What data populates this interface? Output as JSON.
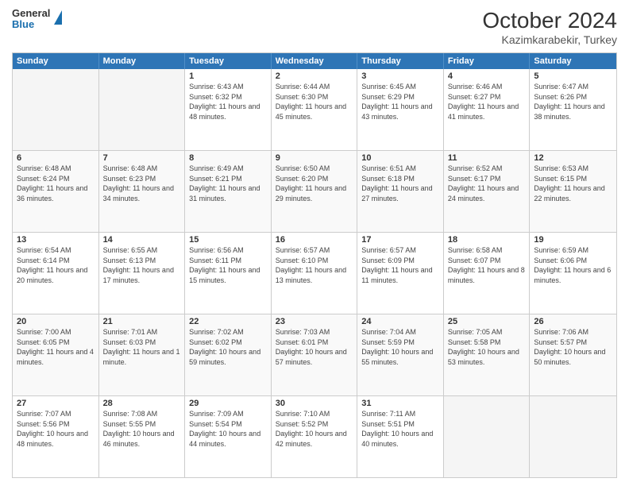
{
  "header": {
    "logo_line1": "General",
    "logo_line2": "Blue",
    "title": "October 2024",
    "subtitle": "Kazimkarabekir, Turkey"
  },
  "days_of_week": [
    "Sunday",
    "Monday",
    "Tuesday",
    "Wednesday",
    "Thursday",
    "Friday",
    "Saturday"
  ],
  "weeks": [
    [
      {
        "day": "",
        "info": "",
        "empty": true
      },
      {
        "day": "",
        "info": "",
        "empty": true
      },
      {
        "day": "1",
        "info": "Sunrise: 6:43 AM\nSunset: 6:32 PM\nDaylight: 11 hours and 48 minutes."
      },
      {
        "day": "2",
        "info": "Sunrise: 6:44 AM\nSunset: 6:30 PM\nDaylight: 11 hours and 45 minutes."
      },
      {
        "day": "3",
        "info": "Sunrise: 6:45 AM\nSunset: 6:29 PM\nDaylight: 11 hours and 43 minutes."
      },
      {
        "day": "4",
        "info": "Sunrise: 6:46 AM\nSunset: 6:27 PM\nDaylight: 11 hours and 41 minutes."
      },
      {
        "day": "5",
        "info": "Sunrise: 6:47 AM\nSunset: 6:26 PM\nDaylight: 11 hours and 38 minutes."
      }
    ],
    [
      {
        "day": "6",
        "info": "Sunrise: 6:48 AM\nSunset: 6:24 PM\nDaylight: 11 hours and 36 minutes."
      },
      {
        "day": "7",
        "info": "Sunrise: 6:48 AM\nSunset: 6:23 PM\nDaylight: 11 hours and 34 minutes."
      },
      {
        "day": "8",
        "info": "Sunrise: 6:49 AM\nSunset: 6:21 PM\nDaylight: 11 hours and 31 minutes."
      },
      {
        "day": "9",
        "info": "Sunrise: 6:50 AM\nSunset: 6:20 PM\nDaylight: 11 hours and 29 minutes."
      },
      {
        "day": "10",
        "info": "Sunrise: 6:51 AM\nSunset: 6:18 PM\nDaylight: 11 hours and 27 minutes."
      },
      {
        "day": "11",
        "info": "Sunrise: 6:52 AM\nSunset: 6:17 PM\nDaylight: 11 hours and 24 minutes."
      },
      {
        "day": "12",
        "info": "Sunrise: 6:53 AM\nSunset: 6:15 PM\nDaylight: 11 hours and 22 minutes."
      }
    ],
    [
      {
        "day": "13",
        "info": "Sunrise: 6:54 AM\nSunset: 6:14 PM\nDaylight: 11 hours and 20 minutes."
      },
      {
        "day": "14",
        "info": "Sunrise: 6:55 AM\nSunset: 6:13 PM\nDaylight: 11 hours and 17 minutes."
      },
      {
        "day": "15",
        "info": "Sunrise: 6:56 AM\nSunset: 6:11 PM\nDaylight: 11 hours and 15 minutes."
      },
      {
        "day": "16",
        "info": "Sunrise: 6:57 AM\nSunset: 6:10 PM\nDaylight: 11 hours and 13 minutes."
      },
      {
        "day": "17",
        "info": "Sunrise: 6:57 AM\nSunset: 6:09 PM\nDaylight: 11 hours and 11 minutes."
      },
      {
        "day": "18",
        "info": "Sunrise: 6:58 AM\nSunset: 6:07 PM\nDaylight: 11 hours and 8 minutes."
      },
      {
        "day": "19",
        "info": "Sunrise: 6:59 AM\nSunset: 6:06 PM\nDaylight: 11 hours and 6 minutes."
      }
    ],
    [
      {
        "day": "20",
        "info": "Sunrise: 7:00 AM\nSunset: 6:05 PM\nDaylight: 11 hours and 4 minutes."
      },
      {
        "day": "21",
        "info": "Sunrise: 7:01 AM\nSunset: 6:03 PM\nDaylight: 11 hours and 1 minute."
      },
      {
        "day": "22",
        "info": "Sunrise: 7:02 AM\nSunset: 6:02 PM\nDaylight: 10 hours and 59 minutes."
      },
      {
        "day": "23",
        "info": "Sunrise: 7:03 AM\nSunset: 6:01 PM\nDaylight: 10 hours and 57 minutes."
      },
      {
        "day": "24",
        "info": "Sunrise: 7:04 AM\nSunset: 5:59 PM\nDaylight: 10 hours and 55 minutes."
      },
      {
        "day": "25",
        "info": "Sunrise: 7:05 AM\nSunset: 5:58 PM\nDaylight: 10 hours and 53 minutes."
      },
      {
        "day": "26",
        "info": "Sunrise: 7:06 AM\nSunset: 5:57 PM\nDaylight: 10 hours and 50 minutes."
      }
    ],
    [
      {
        "day": "27",
        "info": "Sunrise: 7:07 AM\nSunset: 5:56 PM\nDaylight: 10 hours and 48 minutes."
      },
      {
        "day": "28",
        "info": "Sunrise: 7:08 AM\nSunset: 5:55 PM\nDaylight: 10 hours and 46 minutes."
      },
      {
        "day": "29",
        "info": "Sunrise: 7:09 AM\nSunset: 5:54 PM\nDaylight: 10 hours and 44 minutes."
      },
      {
        "day": "30",
        "info": "Sunrise: 7:10 AM\nSunset: 5:52 PM\nDaylight: 10 hours and 42 minutes."
      },
      {
        "day": "31",
        "info": "Sunrise: 7:11 AM\nSunset: 5:51 PM\nDaylight: 10 hours and 40 minutes."
      },
      {
        "day": "",
        "info": "",
        "empty": true
      },
      {
        "day": "",
        "info": "",
        "empty": true
      }
    ]
  ]
}
